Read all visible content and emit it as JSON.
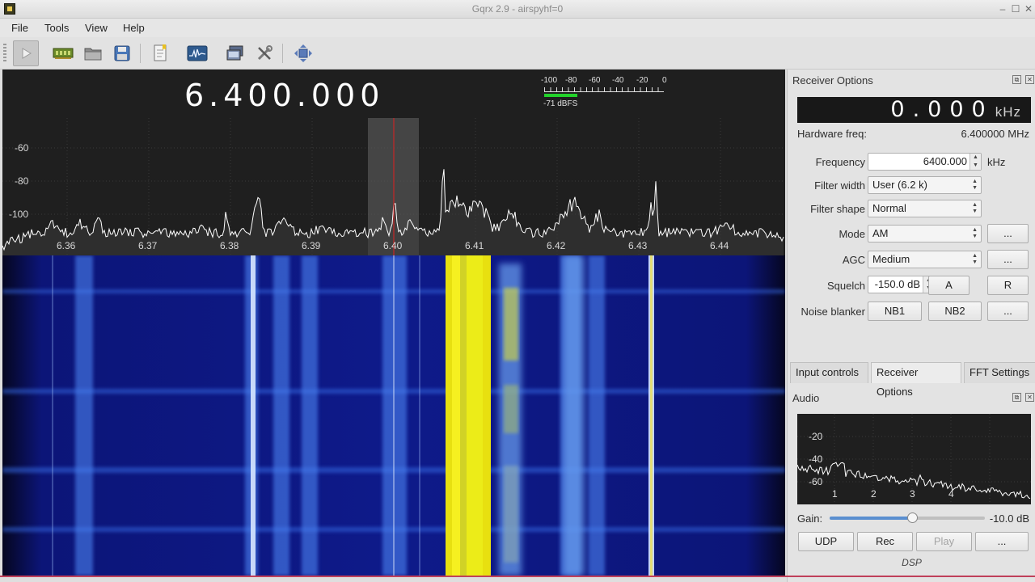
{
  "window": {
    "title": "Gqrx 2.9 - airspyhf=0",
    "controls": [
      "–",
      "☐",
      "✕"
    ]
  },
  "menu": {
    "file": "File",
    "tools": "Tools",
    "view": "View",
    "help": "Help"
  },
  "toolbar": {
    "icons": [
      "play-icon",
      "sdr-device-icon",
      "open-folder-icon",
      "save-icon",
      "bookmark-icon",
      "fft-icon",
      "remote-control-icon",
      "settings-icon",
      "fullscreen-icon"
    ]
  },
  "display": {
    "frequency": "6.400.000",
    "meter": {
      "scale": [
        "-100",
        "-80",
        "-60",
        "-40",
        "-20",
        "0"
      ],
      "level_dbfs": -71,
      "readout": "-71 dBFS",
      "fill_color": "#22d22a"
    },
    "spectrum": {
      "y_labels": [
        "-60",
        "-80",
        "-100"
      ],
      "x_labels": [
        "6.36",
        "6.37",
        "6.38",
        "6.39",
        "6.40",
        "6.41",
        "6.42",
        "6.43",
        "6.44"
      ],
      "trace_color": "#ffffff",
      "demod_line_color": "#e02020"
    }
  },
  "receiver": {
    "header": "Receiver Options",
    "offset_value": "0.000",
    "offset_unit": "kHz",
    "hw_freq_label": "Hardware freq:",
    "hw_freq_value": "6.400000 MHz",
    "frequency_label": "Frequency",
    "frequency_value": "6400.000",
    "frequency_unit": "kHz",
    "filter_width_label": "Filter width",
    "filter_width_value": "User (6.2 k)",
    "filter_shape_label": "Filter shape",
    "filter_shape_value": "Normal",
    "mode_label": "Mode",
    "mode_value": "AM",
    "agc_label": "AGC",
    "agc_value": "Medium",
    "squelch_label": "Squelch",
    "squelch_value": "-150.0 dB",
    "squelch_a": "A",
    "squelch_r": "R",
    "nb_label": "Noise blanker",
    "nb1": "NB1",
    "nb2": "NB2",
    "more": "..."
  },
  "tabs": {
    "input": "Input controls",
    "receiver": "Receiver Options",
    "fft": "FFT Settings"
  },
  "audio": {
    "header": "Audio",
    "y_labels": [
      "-20",
      "-40",
      "-60"
    ],
    "x_labels": [
      "1",
      "2",
      "3",
      "4"
    ],
    "gain_label": "Gain:",
    "gain_value": "-10.0 dB",
    "gain_fraction": 0.53,
    "udp": "UDP",
    "rec": "Rec",
    "play": "Play",
    "more": "...",
    "dsp": "DSP"
  }
}
